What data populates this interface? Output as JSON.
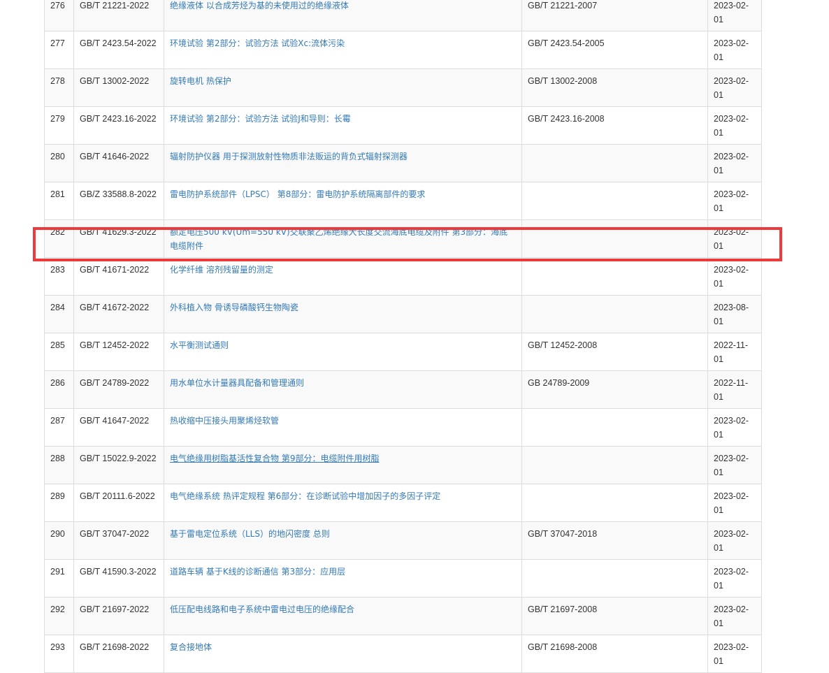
{
  "rows": [
    {
      "no": "276",
      "code": "GB/T 21221-2022",
      "name": "绝缘液体 以合成芳烃为基的未使用过的绝缘液体",
      "replaces": "GB/T 21221-2007",
      "date": "2023-02-01"
    },
    {
      "no": "277",
      "code": "GB/T 2423.54-2022",
      "name": "环境试验 第2部分：试验方法 试验Xc:流体污染",
      "replaces": "GB/T 2423.54-2005",
      "date": "2023-02-01"
    },
    {
      "no": "278",
      "code": "GB/T 13002-2022",
      "name": "旋转电机 热保护",
      "replaces": "GB/T 13002-2008",
      "date": "2023-02-01"
    },
    {
      "no": "279",
      "code": "GB/T 2423.16-2022",
      "name": "环境试验 第2部分：试验方法 试验J和导则：长霉",
      "replaces": "GB/T 2423.16-2008",
      "date": "2023-02-01"
    },
    {
      "no": "280",
      "code": "GB/T 41646-2022",
      "name": "辐射防护仪器 用于探测放射性物质非法贩运的背负式辐射探测器",
      "replaces": "",
      "date": "2023-02-01"
    },
    {
      "no": "281",
      "code": "GB/Z 33588.8-2022",
      "name": "雷电防护系统部件（LPSC） 第8部分：雷电防护系统隔离部件的要求",
      "replaces": "",
      "date": "2023-02-01"
    },
    {
      "no": "282",
      "code": "GB/T 41629.3-2022",
      "name": "额定电压500 kV(Um=550 kV)交联聚乙烯绝缘大长度交流海底电缆及附件 第3部分：海底电缆附件",
      "replaces": "",
      "date": "2023-02-01"
    },
    {
      "no": "283",
      "code": "GB/T 41671-2022",
      "name": "化学纤维 溶剂残留量的测定",
      "replaces": "",
      "date": "2023-02-01"
    },
    {
      "no": "284",
      "code": "GB/T 41672-2022",
      "name": "外科植入物 骨诱导磷酸钙生物陶瓷",
      "replaces": "",
      "date": "2023-08-01"
    },
    {
      "no": "285",
      "code": "GB/T 12452-2022",
      "name": "水平衡测试通则",
      "replaces": "GB/T 12452-2008",
      "date": "2022-11-01"
    },
    {
      "no": "286",
      "code": "GB/T 24789-2022",
      "name": "用水单位水计量器具配备和管理通则",
      "replaces": "GB 24789-2009",
      "date": "2022-11-01"
    },
    {
      "no": "287",
      "code": "GB/T 41647-2022",
      "name": "热收缩中压接头用聚烯烃软管",
      "replaces": "",
      "date": "2023-02-01"
    },
    {
      "no": "288",
      "code": "GB/T 15022.9-2022",
      "name": "电气绝缘用树脂基活性复合物 第9部分：电缆附件用树脂",
      "replaces": "",
      "date": "2023-02-01"
    },
    {
      "no": "289",
      "code": "GB/T 20111.6-2022",
      "name": "电气绝缘系统 热评定规程 第6部分：在诊断试验中增加因子的多因子评定",
      "replaces": "",
      "date": "2023-02-01"
    },
    {
      "no": "290",
      "code": "GB/T 37047-2022",
      "name": "基于雷电定位系统（LLS）的地闪密度 总则",
      "replaces": "GB/T 37047-2018",
      "date": "2023-02-01"
    },
    {
      "no": "291",
      "code": "GB/T 41590.3-2022",
      "name": "道路车辆 基于K线的诊断通信 第3部分：应用层",
      "replaces": "",
      "date": "2023-02-01"
    },
    {
      "no": "292",
      "code": "GB/T 21697-2022",
      "name": "低压配电线路和电子系统中雷电过电压的绝缘配合",
      "replaces": "GB/T 21697-2008",
      "date": "2023-02-01"
    },
    {
      "no": "293",
      "code": "GB/T 21698-2022",
      "name": "复合接地体",
      "replaces": "GB/T 21698-2008",
      "date": "2023-02-01"
    }
  ],
  "colors": {
    "link": "#337ab7",
    "highlight": "#ee3a3a",
    "border": "#dddddd",
    "stripe": "#f9f9f9"
  }
}
